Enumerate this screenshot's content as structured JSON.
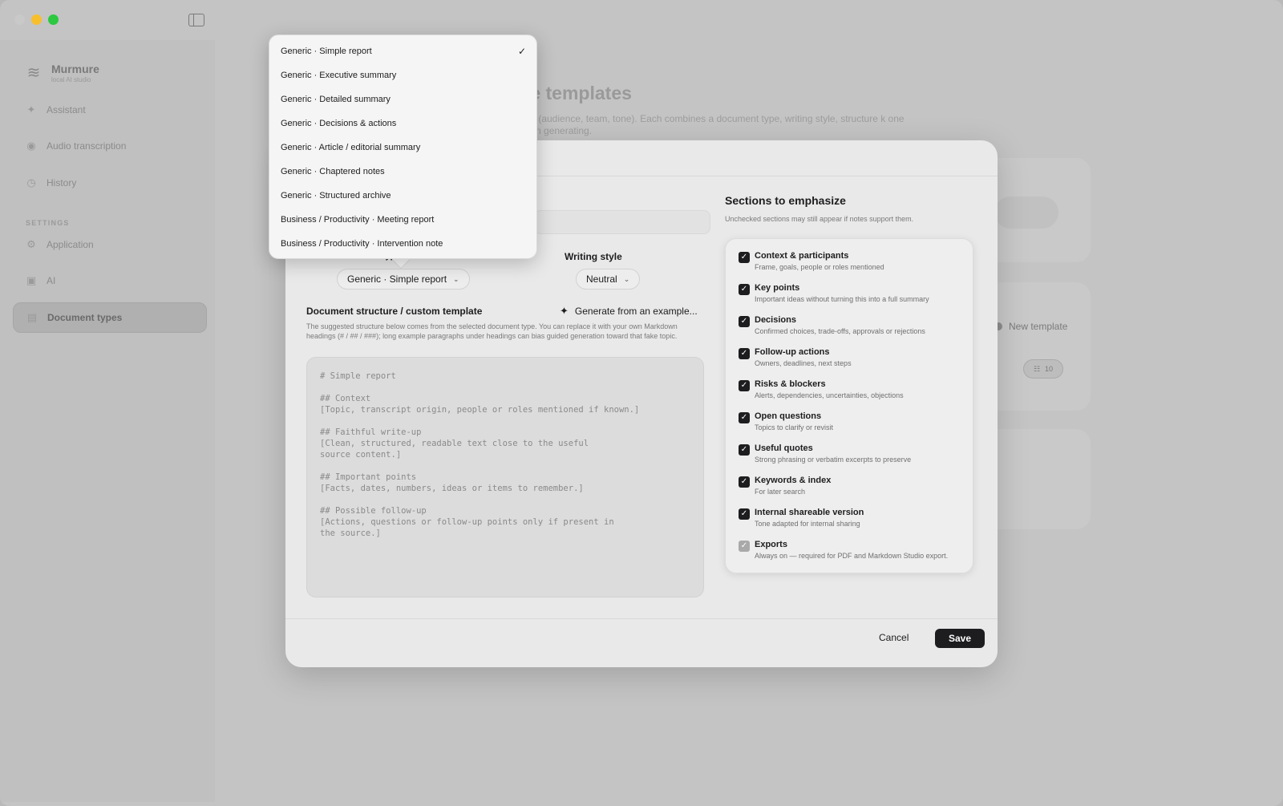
{
  "app": {
    "name": "Murmure",
    "subtitle": "local AI studio"
  },
  "sidebar": {
    "items": [
      {
        "label": "Assistant",
        "icon": "sparkle-icon"
      },
      {
        "label": "Audio transcription",
        "icon": "waveform-icon"
      },
      {
        "label": "History",
        "icon": "clock-icon"
      }
    ],
    "settings_label": "SETTINGS",
    "settings_items": [
      {
        "label": "Application",
        "icon": "gear-icon"
      },
      {
        "label": "AI",
        "icon": "chip-icon"
      },
      {
        "label": "Document types",
        "icon": "document-icon",
        "active": true
      }
    ]
  },
  "page": {
    "title": "Document type templates",
    "description": "sets (audience, team, tone). Each combines a document type, writing style, structure k one when generating."
  },
  "background": {
    "new_template_label": "New template",
    "count": "10"
  },
  "modal": {
    "doc_type_label": "Document type / use case",
    "doc_type_value": "Generic · Simple report",
    "writing_style_label": "Writing style",
    "writing_style_value": "Neutral",
    "structure_label": "Document structure / custom template",
    "generate_label": "Generate from an example...",
    "help_text": "The suggested structure below comes from the selected document type. You can replace it with your own Markdown headings (# / ## / ###); long example paragraphs under headings can bias guided generation toward that fake topic.",
    "template_text": "# Simple report\n\n## Context\n[Topic, transcript origin, people or roles mentioned if known.]\n\n## Faithful write-up\n[Clean, structured, readable text close to the useful\nsource content.]\n\n## Important points\n[Facts, dates, numbers, ideas or items to remember.]\n\n## Possible follow-up\n[Actions, questions or follow-up points only if present in\nthe source.]",
    "sections_title": "Sections to emphasize",
    "sections_subtitle": "Unchecked sections may still appear if notes support them.",
    "sections": [
      {
        "name": "Context & participants",
        "desc": "Frame, goals, people or roles mentioned",
        "checked": true
      },
      {
        "name": "Key points",
        "desc": "Important ideas without turning this into a full summary",
        "checked": true
      },
      {
        "name": "Decisions",
        "desc": "Confirmed choices, trade-offs, approvals or rejections",
        "checked": true
      },
      {
        "name": "Follow-up actions",
        "desc": "Owners, deadlines, next steps",
        "checked": true
      },
      {
        "name": "Risks & blockers",
        "desc": "Alerts, dependencies, uncertainties, objections",
        "checked": true
      },
      {
        "name": "Open questions",
        "desc": "Topics to clarify or revisit",
        "checked": true
      },
      {
        "name": "Useful quotes",
        "desc": "Strong phrasing or verbatim excerpts to preserve",
        "checked": true
      },
      {
        "name": "Keywords & index",
        "desc": "For later search",
        "checked": true
      },
      {
        "name": "Internal shareable version",
        "desc": "Tone adapted for internal sharing",
        "checked": true
      },
      {
        "name": "Exports",
        "desc": "Always on — required for PDF and Markdown Studio export.",
        "checked": true,
        "disabled": true
      }
    ],
    "cancel_label": "Cancel",
    "save_label": "Save"
  },
  "dropdown": {
    "selected": "Generic · Simple report",
    "options": [
      "Generic · Simple report",
      "Generic · Executive summary",
      "Generic · Detailed summary",
      "Generic · Decisions & actions",
      "Generic · Article / editorial summary",
      "Generic · Chaptered notes",
      "Generic · Structured archive",
      "Business / Productivity · Meeting report",
      "Business / Productivity · Intervention note"
    ]
  }
}
